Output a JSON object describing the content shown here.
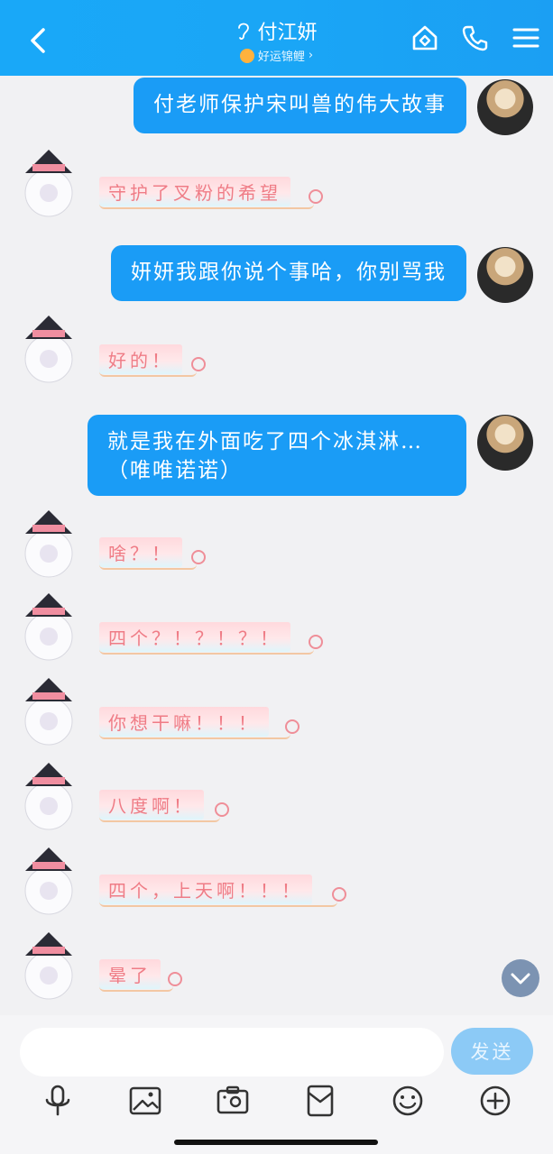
{
  "header": {
    "contact_name": "付江妍",
    "subtitle": "好运锦鲤",
    "subtitle_chevron": "›"
  },
  "messages": [
    {
      "from": "me",
      "text": "付老师保护宋叫兽的伟大故事"
    },
    {
      "from": "other",
      "text": "守护了叉粉的希望"
    },
    {
      "from": "me",
      "text": "妍妍我跟你说个事哈，你别骂我"
    },
    {
      "from": "other",
      "text": "好的！"
    },
    {
      "from": "me",
      "text": "就是我在外面吃了四个冰淇淋…（唯唯诺诺）"
    },
    {
      "from": "other",
      "text": "啥？！"
    },
    {
      "from": "other",
      "text": "四个？！？！？！"
    },
    {
      "from": "other",
      "text": "你想干嘛！！！"
    },
    {
      "from": "other",
      "text": "八度啊！"
    },
    {
      "from": "other",
      "text": "四个，上天啊！！！"
    },
    {
      "from": "other",
      "text": "晕了"
    }
  ],
  "composer": {
    "input_value": "",
    "send_label": "发送"
  },
  "icons": {
    "back": "chevron-left-icon",
    "ear": "ear-icon",
    "home": "home-icon",
    "phone": "phone-icon",
    "menu": "menu-icon",
    "mic": "mic-icon",
    "image": "image-icon",
    "camera": "camera-icon",
    "redpacket": "red-packet-icon",
    "emoji": "emoji-icon",
    "plus": "plus-icon",
    "scroll": "chevron-down-icon"
  },
  "colors": {
    "header": "#1aa6f6",
    "my_bubble": "#1a9cf6",
    "other_text": "#ef7c86",
    "send_button": "#8ccaf6"
  }
}
